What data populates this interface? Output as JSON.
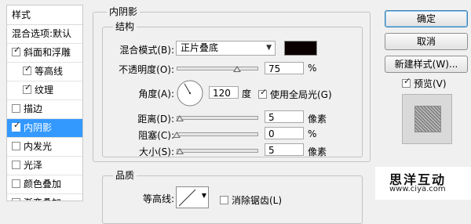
{
  "left_panel": {
    "title": "样式",
    "items": [
      {
        "label": "混合选项:默认",
        "checkbox": false,
        "checked": false,
        "indent": false,
        "selected": false
      },
      {
        "label": "斜面和浮雕",
        "checkbox": true,
        "checked": true,
        "indent": false,
        "selected": false
      },
      {
        "label": "等高线",
        "checkbox": true,
        "checked": true,
        "indent": true,
        "selected": false
      },
      {
        "label": "纹理",
        "checkbox": true,
        "checked": true,
        "indent": true,
        "selected": false
      },
      {
        "label": "描边",
        "checkbox": true,
        "checked": false,
        "indent": false,
        "selected": false
      },
      {
        "label": "内阴影",
        "checkbox": true,
        "checked": true,
        "indent": false,
        "selected": true
      },
      {
        "label": "内发光",
        "checkbox": true,
        "checked": false,
        "indent": false,
        "selected": false
      },
      {
        "label": "光泽",
        "checkbox": true,
        "checked": false,
        "indent": false,
        "selected": false
      },
      {
        "label": "颜色叠加",
        "checkbox": true,
        "checked": false,
        "indent": false,
        "selected": false
      },
      {
        "label": "渐变叠加",
        "checkbox": true,
        "checked": false,
        "indent": false,
        "selected": false
      }
    ]
  },
  "inner_shadow": {
    "group_title": "内阴影",
    "structure_title": "结构",
    "blend_mode": {
      "label": "混合模式(B):",
      "value": "正片叠底",
      "color": "#0a0000"
    },
    "opacity": {
      "label": "不透明度(O):",
      "value": "75",
      "unit": "%",
      "level": 0.75
    },
    "angle": {
      "label": "角度(A):",
      "value": "120",
      "unit": "度",
      "degrees": 120
    },
    "global_light": {
      "label": "使用全局光(G)",
      "checked": true
    },
    "distance": {
      "label": "距离(D):",
      "value": "5",
      "unit": "像素",
      "level": 0.04
    },
    "choke": {
      "label": "阻塞(C):",
      "value": "0",
      "unit": "%",
      "level": 0.0
    },
    "size": {
      "label": "大小(S):",
      "value": "5",
      "unit": "像素",
      "level": 0.04
    },
    "quality_title": "品质",
    "contour": {
      "label": "等高线:",
      "antialias_label": "消除锯齿(L)",
      "antialias_checked": false
    }
  },
  "buttons": {
    "ok": "确定",
    "cancel": "取消",
    "new_style": "新建样式(W)...",
    "preview_label": "预览(V)",
    "preview_checked": true
  },
  "watermark": {
    "text": "思洋互动",
    "url": "www.ciya.com"
  }
}
